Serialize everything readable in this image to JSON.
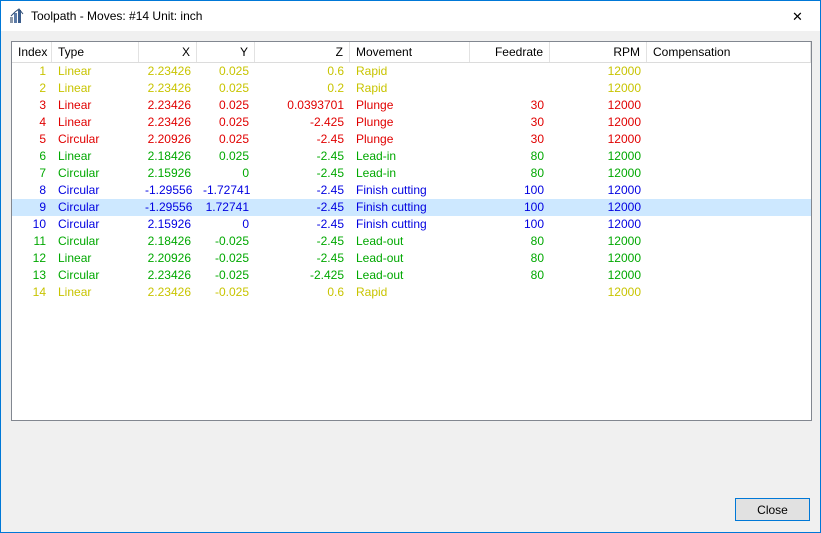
{
  "window": {
    "title": "Toolpath - Moves: #14 Unit: inch",
    "close_icon": "✕"
  },
  "table": {
    "columns": [
      "Index",
      "Type",
      "X",
      "Y",
      "Z",
      "Movement",
      "Feedrate",
      "RPM",
      "Compensation"
    ],
    "rows": [
      {
        "index": "1",
        "type": "Linear",
        "x": "2.23426",
        "y": "0.025",
        "z": "0.6",
        "movement": "Rapid",
        "feedrate": "",
        "rpm": "12000",
        "compensation": "",
        "color_key": "rapid",
        "selected": false
      },
      {
        "index": "2",
        "type": "Linear",
        "x": "2.23426",
        "y": "0.025",
        "z": "0.2",
        "movement": "Rapid",
        "feedrate": "",
        "rpm": "12000",
        "compensation": "",
        "color_key": "rapid",
        "selected": false
      },
      {
        "index": "3",
        "type": "Linear",
        "x": "2.23426",
        "y": "0.025",
        "z": "0.0393701",
        "movement": "Plunge",
        "feedrate": "30",
        "rpm": "12000",
        "compensation": "",
        "color_key": "plunge",
        "selected": false
      },
      {
        "index": "4",
        "type": "Linear",
        "x": "2.23426",
        "y": "0.025",
        "z": "-2.425",
        "movement": "Plunge",
        "feedrate": "30",
        "rpm": "12000",
        "compensation": "",
        "color_key": "plunge",
        "selected": false
      },
      {
        "index": "5",
        "type": "Circular",
        "x": "2.20926",
        "y": "0.025",
        "z": "-2.45",
        "movement": "Plunge",
        "feedrate": "30",
        "rpm": "12000",
        "compensation": "",
        "color_key": "plunge",
        "selected": false
      },
      {
        "index": "6",
        "type": "Linear",
        "x": "2.18426",
        "y": "0.025",
        "z": "-2.45",
        "movement": "Lead-in",
        "feedrate": "80",
        "rpm": "12000",
        "compensation": "",
        "color_key": "lead",
        "selected": false
      },
      {
        "index": "7",
        "type": "Circular",
        "x": "2.15926",
        "y": "0",
        "z": "-2.45",
        "movement": "Lead-in",
        "feedrate": "80",
        "rpm": "12000",
        "compensation": "",
        "color_key": "lead",
        "selected": false
      },
      {
        "index": "8",
        "type": "Circular",
        "x": "-1.29556",
        "y": "-1.72741",
        "z": "-2.45",
        "movement": "Finish cutting",
        "feedrate": "100",
        "rpm": "12000",
        "compensation": "",
        "color_key": "finish",
        "selected": false
      },
      {
        "index": "9",
        "type": "Circular",
        "x": "-1.29556",
        "y": "1.72741",
        "z": "-2.45",
        "movement": "Finish cutting",
        "feedrate": "100",
        "rpm": "12000",
        "compensation": "",
        "color_key": "finish",
        "selected": true
      },
      {
        "index": "10",
        "type": "Circular",
        "x": "2.15926",
        "y": "0",
        "z": "-2.45",
        "movement": "Finish cutting",
        "feedrate": "100",
        "rpm": "12000",
        "compensation": "",
        "color_key": "finish",
        "selected": false
      },
      {
        "index": "11",
        "type": "Circular",
        "x": "2.18426",
        "y": "-0.025",
        "z": "-2.45",
        "movement": "Lead-out",
        "feedrate": "80",
        "rpm": "12000",
        "compensation": "",
        "color_key": "lead",
        "selected": false
      },
      {
        "index": "12",
        "type": "Linear",
        "x": "2.20926",
        "y": "-0.025",
        "z": "-2.45",
        "movement": "Lead-out",
        "feedrate": "80",
        "rpm": "12000",
        "compensation": "",
        "color_key": "lead",
        "selected": false
      },
      {
        "index": "13",
        "type": "Circular",
        "x": "2.23426",
        "y": "-0.025",
        "z": "-2.425",
        "movement": "Lead-out",
        "feedrate": "80",
        "rpm": "12000",
        "compensation": "",
        "color_key": "lead",
        "selected": false
      },
      {
        "index": "14",
        "type": "Linear",
        "x": "2.23426",
        "y": "-0.025",
        "z": "0.6",
        "movement": "Rapid",
        "feedrate": "",
        "rpm": "12000",
        "compensation": "",
        "color_key": "rapid",
        "selected": false
      }
    ]
  },
  "footer": {
    "close_label": "Close"
  },
  "colors": {
    "rapid": "#c8c400",
    "plunge": "#e00000",
    "lead": "#00a800",
    "finish": "#0000e0",
    "selection_background": "#cde8ff",
    "window_border": "#0078d7"
  }
}
